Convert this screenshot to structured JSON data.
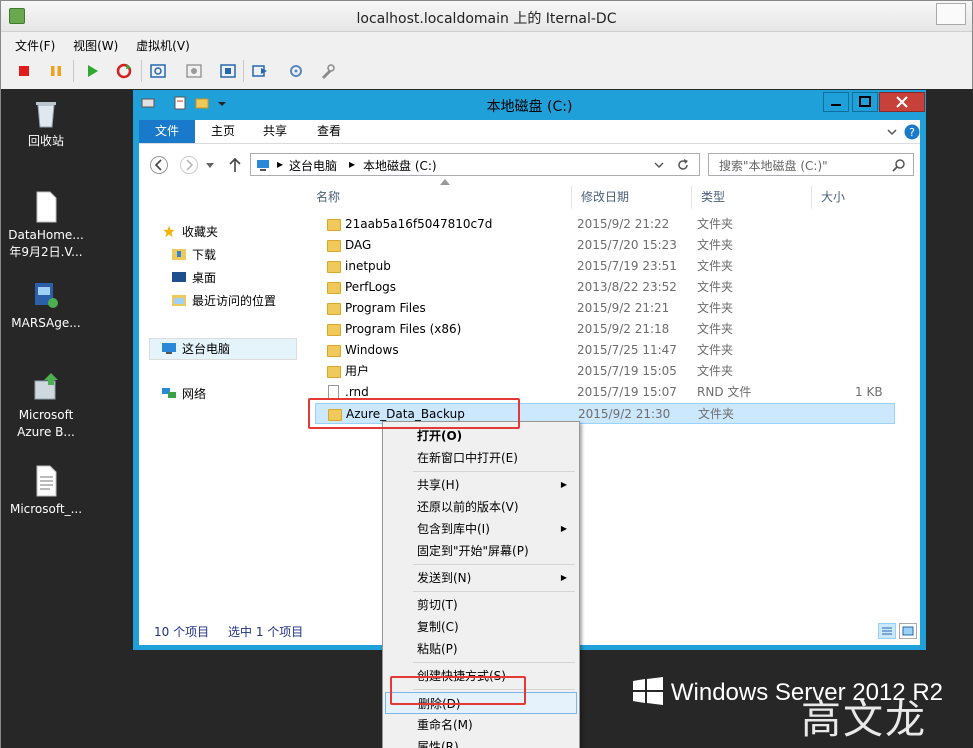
{
  "host": {
    "title": "localhost.localdomain 上的 Iternal-DC",
    "menu": [
      "文件(F)",
      "视图(W)",
      "虚拟机(V)"
    ],
    "toolbar_icons": [
      "stop-icon",
      "pause-icon",
      "play-icon",
      "reset-icon",
      "snapshot-icon",
      "revert-icon",
      "snapshot-manager-icon",
      "send-keys-icon",
      "settings-icon",
      "tools-icon"
    ]
  },
  "desktop": {
    "icons": [
      {
        "label": "回收站",
        "icon": "recycle-bin-icon"
      },
      {
        "label": "DataHome...\n年9月2日.V...",
        "icon": "document-icon"
      },
      {
        "label": "MARSAge...",
        "icon": "installer-icon"
      },
      {
        "label": "Microsoft\nAzure B...",
        "icon": "azure-backup-icon"
      },
      {
        "label": "Microsoft_...",
        "icon": "text-file-icon"
      }
    ],
    "watermark": "Windows Server 2012 R2",
    "signature": "高文龙"
  },
  "explorer": {
    "title": "本地磁盘 (C:)",
    "ribbon_tabs": [
      "文件",
      "主页",
      "共享",
      "查看"
    ],
    "breadcrumb": [
      "这台电脑",
      "本地磁盘 (C:)"
    ],
    "search_placeholder": "搜索\"本地磁盘 (C:)\"",
    "nav": {
      "favorites": "收藏夹",
      "downloads": "下载",
      "desktop": "桌面",
      "recent": "最近访问的位置",
      "thispc": "这台电脑",
      "network": "网络"
    },
    "columns": [
      "名称",
      "修改日期",
      "类型",
      "大小"
    ],
    "files": [
      {
        "name": "21aab5a16f5047810c7d",
        "date": "2015/9/2 21:22",
        "type": "文件夹",
        "size": ""
      },
      {
        "name": "DAG",
        "date": "2015/7/20 15:23",
        "type": "文件夹",
        "size": ""
      },
      {
        "name": "inetpub",
        "date": "2015/7/19 23:51",
        "type": "文件夹",
        "size": ""
      },
      {
        "name": "PerfLogs",
        "date": "2013/8/22 23:52",
        "type": "文件夹",
        "size": ""
      },
      {
        "name": "Program Files",
        "date": "2015/9/2 21:21",
        "type": "文件夹",
        "size": ""
      },
      {
        "name": "Program Files (x86)",
        "date": "2015/9/2 21:18",
        "type": "文件夹",
        "size": ""
      },
      {
        "name": "Windows",
        "date": "2015/7/25 11:47",
        "type": "文件夹",
        "size": ""
      },
      {
        "name": "用户",
        "date": "2015/7/19 15:05",
        "type": "文件夹",
        "size": ""
      },
      {
        "name": ".rnd",
        "date": "2015/7/19 15:07",
        "type": "RND 文件",
        "size": "1 KB"
      },
      {
        "name": "Azure_Data_Backup",
        "date": "2015/9/2 21:30",
        "type": "文件夹",
        "size": ""
      }
    ],
    "status": {
      "count": "10 个项目",
      "selected": "选中 1 个项目"
    }
  },
  "context_menu": {
    "items": [
      {
        "label": "打开(O)",
        "bold": true
      },
      {
        "label": "在新窗口中打开(E)"
      },
      {
        "label": "共享(H)",
        "submenu": true
      },
      {
        "label": "还原以前的版本(V)"
      },
      {
        "label": "包含到库中(I)",
        "submenu": true
      },
      {
        "label": "固定到\"开始\"屏幕(P)"
      },
      {
        "label": "发送到(N)",
        "submenu": true
      },
      {
        "label": "剪切(T)"
      },
      {
        "label": "复制(C)"
      },
      {
        "label": "粘贴(P)"
      },
      {
        "label": "创建快捷方式(S)"
      },
      {
        "label": "删除(D)",
        "highlighted": true
      },
      {
        "label": "重命名(M)"
      },
      {
        "label": "属性(R)"
      }
    ],
    "arrow_glyph": "▶"
  }
}
